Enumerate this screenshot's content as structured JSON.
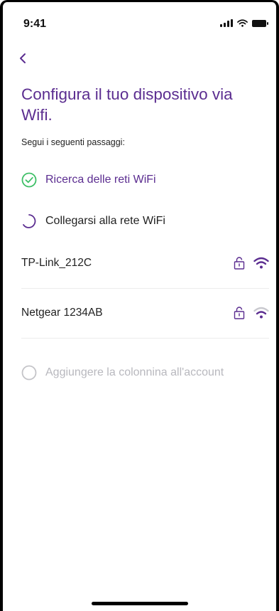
{
  "status_bar": {
    "time": "9:41"
  },
  "colors": {
    "accent": "#5b2d90",
    "success": "#3dbf66",
    "disabled": "#c4c4c8"
  },
  "header": {
    "back_icon": "chevron-left-icon",
    "title": "Configura il tuo dispositivo via Wifi.",
    "subtitle": "Segui i seguenti passaggi:"
  },
  "steps": [
    {
      "label": "Ricerca delle reti WiFi",
      "state": "completed",
      "icon": "check-circle-icon"
    },
    {
      "label": "Collegarsi alla rete WiFi",
      "state": "in-progress",
      "icon": "spinner-icon"
    },
    {
      "label": "Aggiungere la colonnina all'account",
      "state": "pending",
      "icon": "empty-circle-icon"
    }
  ],
  "networks": [
    {
      "ssid": "TP-Link_212C",
      "secured": true,
      "signal": "strong"
    },
    {
      "ssid": "Netgear 1234AB",
      "secured": true,
      "signal": "medium"
    }
  ]
}
